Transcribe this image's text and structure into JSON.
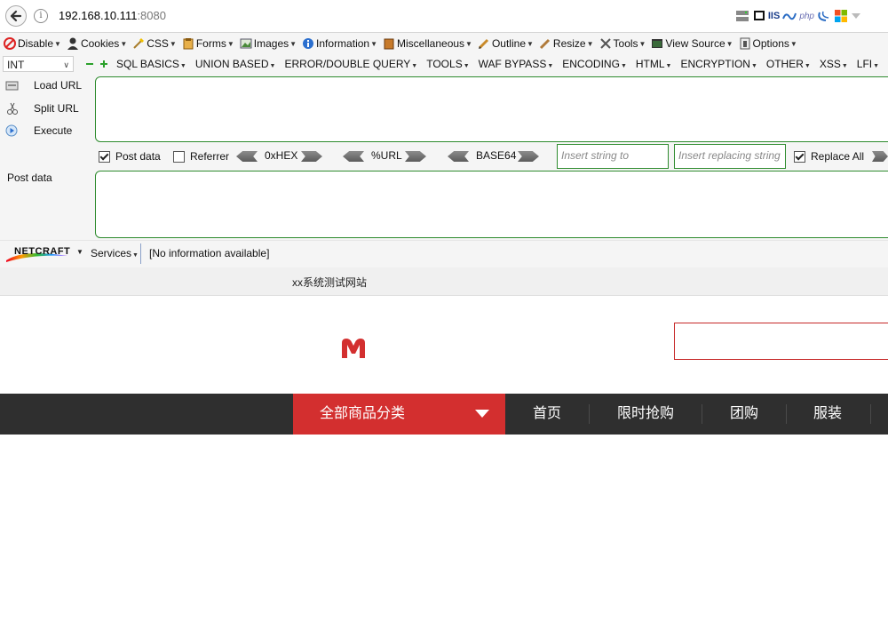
{
  "address_bar": {
    "url_host": "192.168.10.111",
    "url_port": ":8080"
  },
  "toolbar_icons": [
    "server-icon",
    "iis-label",
    "php-label",
    "windows-icon"
  ],
  "toolbar_icon_text": {
    "iis": "IIS",
    "php": "php"
  },
  "menubar": {
    "items": [
      {
        "label": "Disable",
        "icon": "disable-icon"
      },
      {
        "label": "Cookies",
        "icon": "cookies-icon"
      },
      {
        "label": "CSS",
        "icon": "css-icon"
      },
      {
        "label": "Forms",
        "icon": "forms-icon"
      },
      {
        "label": "Images",
        "icon": "images-icon"
      },
      {
        "label": "Information",
        "icon": "information-icon"
      },
      {
        "label": "Miscellaneous",
        "icon": "misc-icon"
      },
      {
        "label": "Outline",
        "icon": "outline-icon"
      },
      {
        "label": "Resize",
        "icon": "resize-icon"
      },
      {
        "label": "Tools",
        "icon": "tools-icon"
      },
      {
        "label": "View Source",
        "icon": "view-source-icon"
      },
      {
        "label": "Options",
        "icon": "options-icon"
      }
    ]
  },
  "hackbar_menu": {
    "int_select": "INT",
    "items": [
      "SQL BASICS",
      "UNION BASED",
      "ERROR/DOUBLE QUERY",
      "TOOLS",
      "WAF BYPASS",
      "ENCODING",
      "HTML",
      "ENCRYPTION",
      "OTHER",
      "XSS",
      "LFI"
    ]
  },
  "hackbar": {
    "load_url": "Load URL",
    "split_url": "Split URL",
    "execute": "Execute",
    "url_value": "",
    "post_data_check": "Post data",
    "referrer_check": "Referrer",
    "hex_label": "0xHEX",
    "url_label": "%URL",
    "base64_label": "BASE64",
    "replace_placeholder": "Insert string to replace",
    "replacing_placeholder": "Insert replacing string",
    "replace_all": "Replace All",
    "post_data_label": "Post data",
    "post_value": ""
  },
  "netcraft": {
    "logo": "NETCRAFT",
    "services": "Services",
    "info": "[No information available]"
  },
  "tab_title": "xx系统测试网站",
  "page": {
    "categories_label": "全部商品分类",
    "nav_items": [
      "首页",
      "限时抢购",
      "团购",
      "服装"
    ]
  },
  "colors": {
    "brand_red": "#d32f2f",
    "nav_bg": "#2f2f2f",
    "hackbar_green": "#2e8b2e"
  }
}
